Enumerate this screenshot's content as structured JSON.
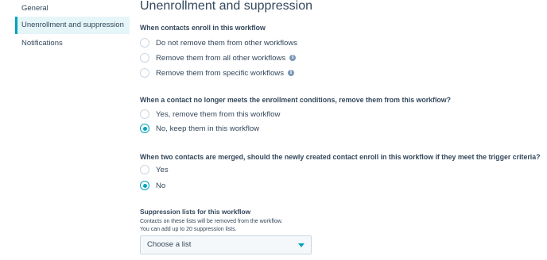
{
  "sidebar": {
    "items": [
      {
        "label": "General"
      },
      {
        "label": "Unenrollment and suppression"
      },
      {
        "label": "Notifications"
      }
    ]
  },
  "main": {
    "title": "Unenrollment and suppression",
    "sections": [
      {
        "question": "When contacts enroll in this workflow",
        "options": [
          {
            "label": "Do not remove them from other workflows",
            "selected": false
          },
          {
            "label": "Remove them from all other workflows",
            "selected": false
          },
          {
            "label": "Remove them from specific workflows",
            "selected": false
          }
        ]
      },
      {
        "question": "When a contact no longer meets the enrollment conditions, remove them from this workflow?",
        "options": [
          {
            "label": "Yes, remove them from this workflow",
            "selected": false
          },
          {
            "label": "No, keep them in this workflow",
            "selected": true
          }
        ]
      },
      {
        "question": "When two contacts are merged, should the newly created contact enroll in this workflow if they meet the trigger criteria?",
        "options": [
          {
            "label": "Yes",
            "selected": false
          },
          {
            "label": "No",
            "selected": true
          }
        ]
      }
    ],
    "suppression": {
      "title": "Suppression lists for this workflow",
      "desc1": "Contacts on these lists will be removed from the workflow.",
      "desc2": "You can add up to 20 suppression lists.",
      "select_placeholder": "Choose a list"
    }
  },
  "colors": {
    "accent": "#00a4bd",
    "text": "#33475b",
    "active_bg": "#e5f5f8",
    "info_icon": "#7c98b6"
  },
  "icons": {
    "info": "info-icon",
    "dropdown": "caret-down-icon"
  }
}
